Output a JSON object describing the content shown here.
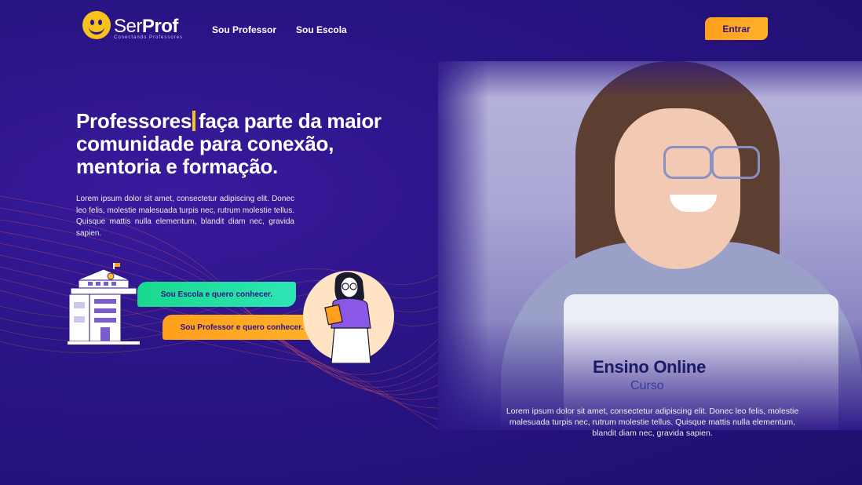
{
  "header": {
    "logo_ser": "Ser",
    "logo_prof": "Prof",
    "logo_tagline": "Conectando Professores",
    "nav": [
      {
        "label": "Sou Professor"
      },
      {
        "label": "Sou Escola"
      }
    ],
    "login_label": "Entrar"
  },
  "hero": {
    "title_word": "Professores",
    "title_rest": "faça parte da maior comunidade para conexão, mentoria e formação.",
    "description": "Lorem ipsum dolor sit amet, consectetur adipiscing elit. Donec leo felis, molestie malesuada turpis nec, rutrum molestie tellus. Quisque mattis nulla elementum, blandit diam nec, gravida sapien.",
    "cta_school": "Sou Escola e quero conhecer.",
    "cta_teacher": "Sou Professor e quero conhecer."
  },
  "course": {
    "title": "Ensino Online",
    "subtitle": "Curso",
    "description": "Lorem ipsum dolor sit amet, consectetur adipiscing elit. Donec leo felis, molestie malesuada turpis nec, rutrum molestie tellus. Quisque mattis nulla elementum, blandit diam nec, gravida sapien."
  },
  "colors": {
    "background": "#2a1486",
    "accent_orange": "#ff9f1c",
    "accent_green": "#19d98e",
    "accent_yellow": "#f7c21c"
  },
  "icons": [
    "smiley-logo-icon",
    "school-building-icon",
    "teacher-illustration-icon"
  ]
}
